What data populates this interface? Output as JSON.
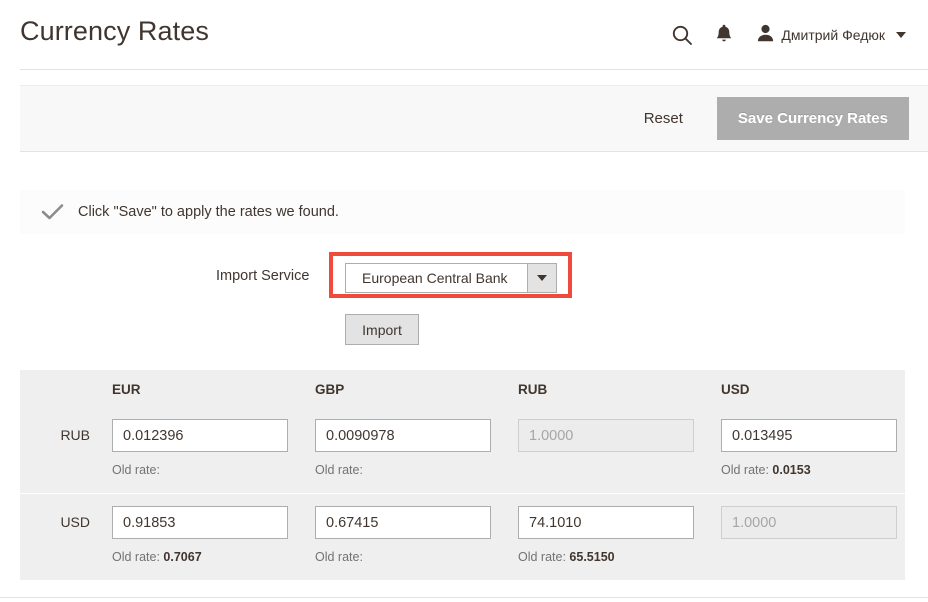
{
  "header": {
    "title": "Currency Rates",
    "search_icon": "search-icon",
    "notifications_icon": "bell-icon",
    "account_icon": "user-icon",
    "account_name": "Дмитрий Федюк",
    "account_caret": "chevron-down-icon"
  },
  "toolbar": {
    "reset_label": "Reset",
    "save_label": "Save Currency Rates",
    "save_bg": "#adadad"
  },
  "message": {
    "icon": "checkmark-icon",
    "text": "Click \"Save\" to apply the rates we found."
  },
  "import": {
    "service_label": "Import Service",
    "service_value": "European Central Bank",
    "service_caret": "chevron-down-icon",
    "highlight_color": "#ef4b3c",
    "import_label": "Import"
  },
  "rates": {
    "columns": [
      "EUR",
      "GBP",
      "RUB",
      "USD"
    ],
    "rows": [
      {
        "label": "RUB",
        "cells": [
          {
            "value": "0.012396",
            "disabled": false,
            "old_rate_label": "Old rate:",
            "old_rate_value": ""
          },
          {
            "value": "0.0090978",
            "disabled": false,
            "old_rate_label": "Old rate:",
            "old_rate_value": ""
          },
          {
            "value": "1.0000",
            "disabled": true,
            "old_rate_label": "",
            "old_rate_value": ""
          },
          {
            "value": "0.013495",
            "disabled": false,
            "old_rate_label": "Old rate:",
            "old_rate_value": "0.0153"
          }
        ]
      },
      {
        "label": "USD",
        "cells": [
          {
            "value": "0.91853",
            "disabled": false,
            "old_rate_label": "Old rate:",
            "old_rate_value": "0.7067"
          },
          {
            "value": "0.67415",
            "disabled": false,
            "old_rate_label": "Old rate:",
            "old_rate_value": ""
          },
          {
            "value": "74.1010",
            "disabled": false,
            "old_rate_label": "Old rate:",
            "old_rate_value": "65.5150"
          },
          {
            "value": "1.0000",
            "disabled": true,
            "old_rate_label": "",
            "old_rate_value": ""
          }
        ]
      }
    ]
  }
}
